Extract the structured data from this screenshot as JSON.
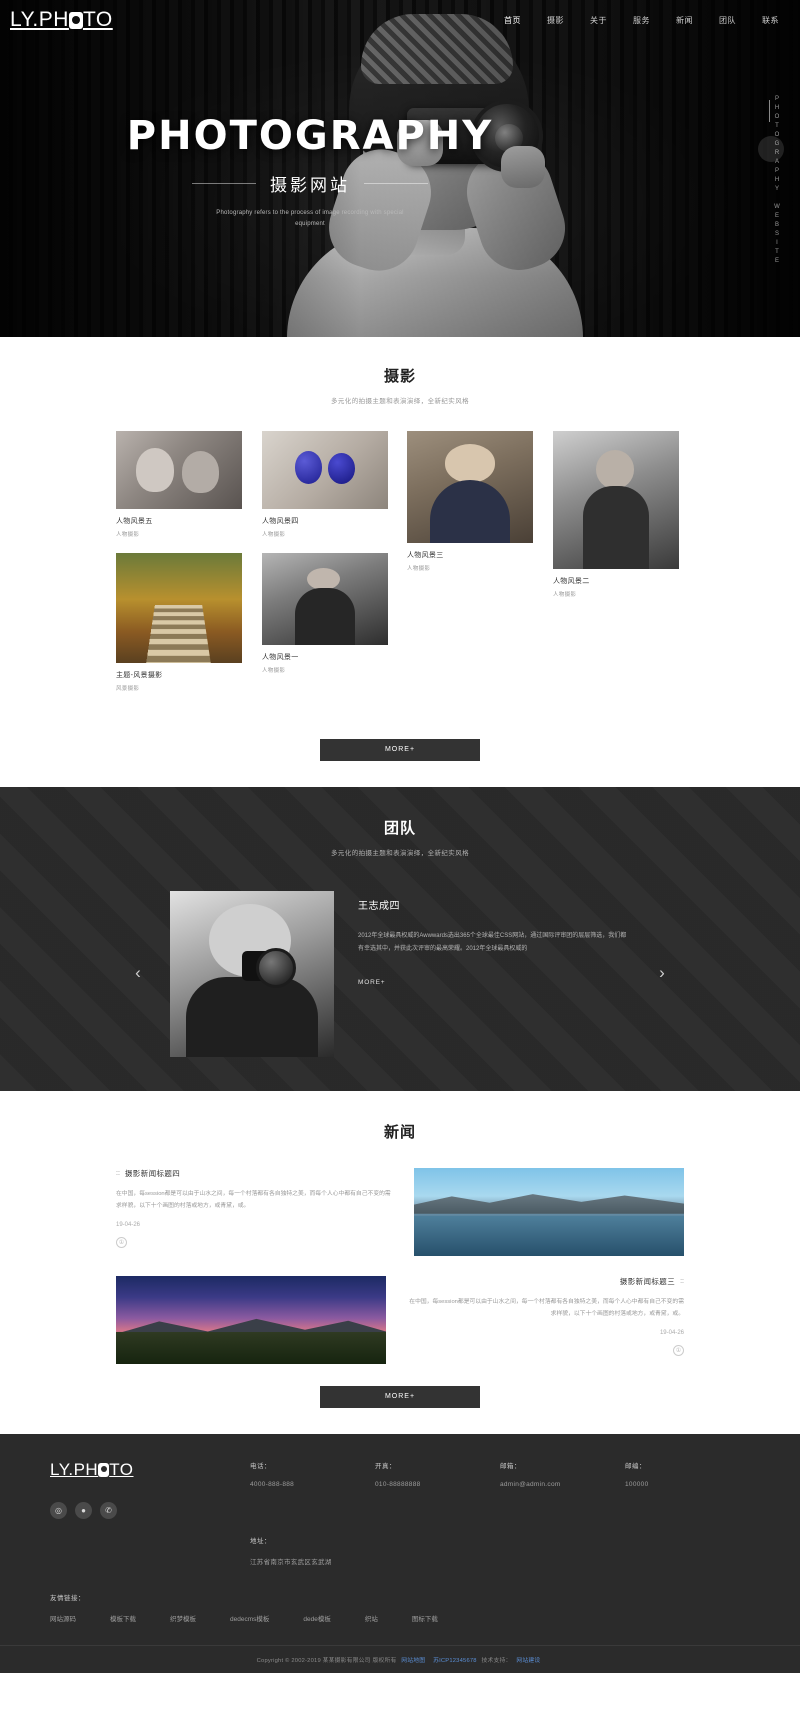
{
  "brand": {
    "logo_pre": "LY.PH",
    "logo_post": "TO"
  },
  "nav": {
    "items": [
      {
        "label": "首页",
        "active": true
      },
      {
        "label": "摄影",
        "active": false
      },
      {
        "label": "关于",
        "active": false
      },
      {
        "label": "服务",
        "active": false
      },
      {
        "label": "新闻",
        "active": false
      },
      {
        "label": "团队",
        "active": false
      },
      {
        "label": "联系",
        "active": false
      }
    ]
  },
  "hero": {
    "title": "PHOTOGRAPHY",
    "subtitle": "摄影网站",
    "description": "Photography refers to the process of image recording with special equipment",
    "vertical_text": "PHOTOGRAPHY WEBSITE"
  },
  "gallery": {
    "title": "摄影",
    "subtitle": "多元化的拍摄主题和表演演绎，全新纪实风格",
    "more_label": "MORE+",
    "items": [
      {
        "caption": "人物风景五",
        "category": "人物摄影"
      },
      {
        "caption": "人物风景四",
        "category": "人物摄影"
      },
      {
        "caption": "人物风景三",
        "category": "人物摄影"
      },
      {
        "caption": "人物风景二",
        "category": "人物摄影"
      },
      {
        "caption": "主题-风景摄影",
        "category": "风景摄影"
      },
      {
        "caption": "人物风景一",
        "category": "人物摄影"
      }
    ]
  },
  "team": {
    "title": "团队",
    "subtitle": "多元化的拍摄主题和表演演绎，全新纪实风格",
    "member_name": "王志成四",
    "member_desc": "2012年全球最具权威的Awwwards选出365个全球最佳CSS网站，通过国际评审团的层层筛选，我们都有幸选其中，并获此次评审的最高荣耀。2012年全球最具权威的",
    "more_label": "MORE+",
    "prev_icon": "chevron-left-icon",
    "next_icon": "chevron-right-icon"
  },
  "news": {
    "title": "新闻",
    "more_label": "MORE+",
    "items": [
      {
        "title": "摄影新闻标题四",
        "body": "在中国，每session都是可以由于山水之间，每一个村落都有各自独特之美，而每个人心中都有自己不变的需求样貌，以下十个画图的村落或地方，或青黛，或。",
        "date": "19-04-26",
        "bullet": "::",
        "marker": "①"
      },
      {
        "title": "摄影新闻标题三",
        "body": "在中国，每session都是可以由于山水之间，每一个村落都有各自独特之美，而每个人心中都有自己不变的需求样貌，以下十个画图的村落或地方，或青黛，或。",
        "date": "19-04-26",
        "bullet": "::",
        "marker": "①"
      }
    ]
  },
  "footer": {
    "logo_pre": "LY.PH",
    "logo_post": "TO",
    "socials": [
      {
        "name": "weibo-icon",
        "glyph": "◎"
      },
      {
        "name": "qq-icon",
        "glyph": "●"
      },
      {
        "name": "wechat-icon",
        "glyph": "✆"
      }
    ],
    "contacts": [
      {
        "label": "电话：",
        "value": "4000-888-888"
      },
      {
        "label": "开真：",
        "value": "010-88888888"
      },
      {
        "label": "邮箱：",
        "value": "admin@admin.com"
      },
      {
        "label": "邮编：",
        "value": "100000"
      }
    ],
    "address": {
      "label": "地址：",
      "value": "江苏省南京市玄武区玄武湖"
    },
    "links_label": "友情链接：",
    "links": [
      "网站源码",
      "模板下载",
      "织梦模板",
      "dedecms模板",
      "dede模板",
      "织站",
      "图标下载"
    ],
    "copyright_pre": "Copyright © 2002-2019 某某摄影有限公司 版权所有",
    "icp_link": "网站地图",
    "icp_no": "苏ICP12345678",
    "tech_text": "技术支持：",
    "tech_link": "网站建设"
  }
}
